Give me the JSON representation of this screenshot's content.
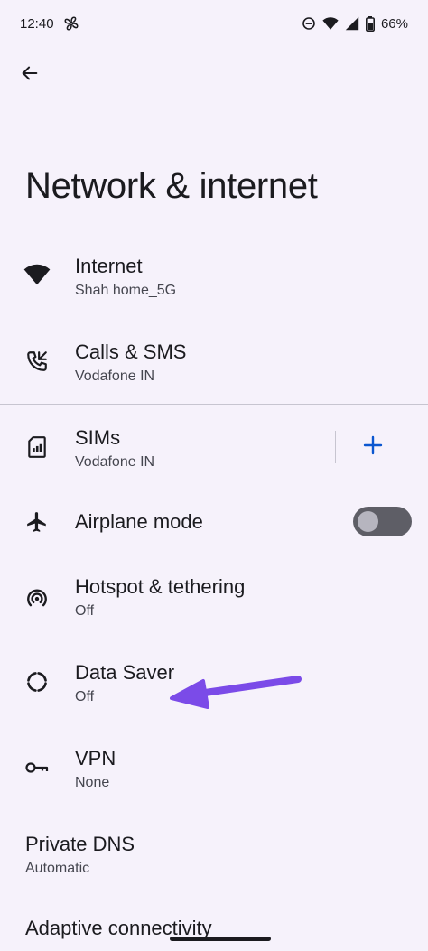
{
  "status_bar": {
    "time": "12:40",
    "battery": "66%",
    "icons": [
      "fan-notification-icon",
      "do-not-disturb-icon",
      "wifi-icon",
      "signal-icon",
      "battery-icon"
    ]
  },
  "page": {
    "title": "Network & internet"
  },
  "items": [
    {
      "id": "internet",
      "icon": "wifi-icon",
      "title": "Internet",
      "subtitle": "Shah home_5G"
    },
    {
      "id": "calls-sms",
      "icon": "phone-forward-icon",
      "title": "Calls & SMS",
      "subtitle": "Vodafone IN"
    },
    {
      "id": "sims",
      "icon": "sim-card-icon",
      "title": "SIMs",
      "subtitle": "Vodafone IN",
      "action": "+"
    },
    {
      "id": "airplane",
      "icon": "airplane-icon",
      "title": "Airplane mode",
      "toggle": false
    },
    {
      "id": "hotspot",
      "icon": "hotspot-icon",
      "title": "Hotspot & tethering",
      "subtitle": "Off"
    },
    {
      "id": "data-saver",
      "icon": "data-saver-icon",
      "title": "Data Saver",
      "subtitle": "Off"
    },
    {
      "id": "vpn",
      "icon": "key-icon",
      "title": "VPN",
      "subtitle": "None"
    },
    {
      "id": "private-dns",
      "title": "Private DNS",
      "subtitle": "Automatic"
    },
    {
      "id": "adaptive",
      "title": "Adaptive connectivity"
    }
  ],
  "colors": {
    "background": "#f6f2fb",
    "text": "#1b1b1f",
    "subtext": "#45464f",
    "accent": "#0b57d0",
    "annotation_arrow": "#7b4be8",
    "toggle_off": "#5e5e66"
  }
}
